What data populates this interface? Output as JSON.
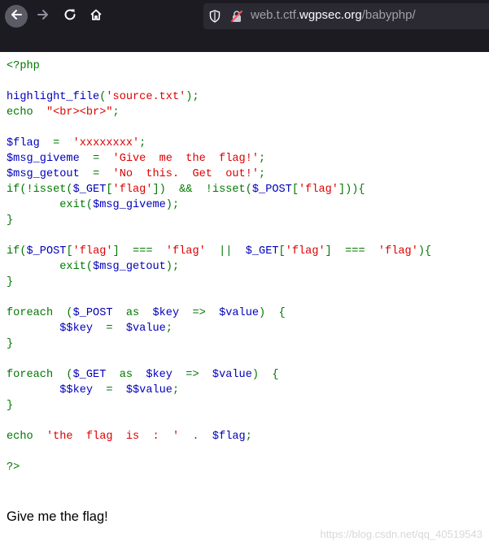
{
  "browser": {
    "url_prefix": "web.t.ctf.",
    "url_domain": "wgpsec.org",
    "url_path": "/babyphp/"
  },
  "source_code": [
    [
      [
        "k",
        "<?php"
      ]
    ],
    [],
    [
      [
        "v",
        "highlight_file"
      ],
      [
        "k",
        "("
      ],
      [
        "s",
        "'source.txt'"
      ],
      [
        "k",
        ");"
      ]
    ],
    [
      [
        "k",
        "echo  "
      ],
      [
        "s",
        "\"<br><br>\""
      ],
      [
        "k",
        ";"
      ]
    ],
    [],
    [
      [
        "v",
        "$flag  "
      ],
      [
        "k",
        "= "
      ],
      [
        "s",
        " 'xxxxxxxx'"
      ],
      [
        "k",
        ";"
      ]
    ],
    [
      [
        "v",
        "$msg_giveme  "
      ],
      [
        "k",
        "= "
      ],
      [
        "s",
        " 'Give  me  the  flag!'"
      ],
      [
        "k",
        ";"
      ]
    ],
    [
      [
        "v",
        "$msg_getout  "
      ],
      [
        "k",
        "= "
      ],
      [
        "s",
        " 'No  this.  Get  out!'"
      ],
      [
        "k",
        ";"
      ]
    ],
    [
      [
        "k",
        "if(!isset("
      ],
      [
        "v",
        "$_GET"
      ],
      [
        "k",
        "["
      ],
      [
        "s",
        "'flag'"
      ],
      [
        "k",
        "])  &&  !isset("
      ],
      [
        "v",
        "$_POST"
      ],
      [
        "k",
        "["
      ],
      [
        "s",
        "'flag'"
      ],
      [
        "k",
        "])){"
      ]
    ],
    [
      [
        "k",
        "        exit("
      ],
      [
        "v",
        "$msg_giveme"
      ],
      [
        "k",
        ");"
      ]
    ],
    [
      [
        "k",
        "}"
      ]
    ],
    [],
    [
      [
        "k",
        "if("
      ],
      [
        "v",
        "$_POST"
      ],
      [
        "k",
        "["
      ],
      [
        "s",
        "'flag'"
      ],
      [
        "k",
        "]  ===  "
      ],
      [
        "s",
        "'flag'"
      ],
      [
        "k",
        "  ||  "
      ],
      [
        "v",
        "$_GET"
      ],
      [
        "k",
        "["
      ],
      [
        "s",
        "'flag'"
      ],
      [
        "k",
        "]  ===  "
      ],
      [
        "s",
        "'flag'"
      ],
      [
        "k",
        "){"
      ]
    ],
    [
      [
        "k",
        "        exit("
      ],
      [
        "v",
        "$msg_getout"
      ],
      [
        "k",
        ");"
      ]
    ],
    [
      [
        "k",
        "}"
      ]
    ],
    [],
    [
      [
        "k",
        "foreach  ("
      ],
      [
        "v",
        "$_POST  "
      ],
      [
        "k",
        "as  "
      ],
      [
        "v",
        "$key  "
      ],
      [
        "k",
        "=>  "
      ],
      [
        "v",
        "$value"
      ],
      [
        "k",
        ")  {"
      ]
    ],
    [
      [
        "v",
        "        $$key  "
      ],
      [
        "k",
        "=  "
      ],
      [
        "v",
        "$value"
      ],
      [
        "k",
        ";"
      ]
    ],
    [
      [
        "k",
        "}"
      ]
    ],
    [],
    [
      [
        "k",
        "foreach  ("
      ],
      [
        "v",
        "$_GET  "
      ],
      [
        "k",
        "as  "
      ],
      [
        "v",
        "$key  "
      ],
      [
        "k",
        "=>  "
      ],
      [
        "v",
        "$value"
      ],
      [
        "k",
        ")  {"
      ]
    ],
    [
      [
        "v",
        "        $$key  "
      ],
      [
        "k",
        "=  "
      ],
      [
        "v",
        "$$value"
      ],
      [
        "k",
        ";"
      ]
    ],
    [
      [
        "k",
        "}"
      ]
    ],
    [],
    [
      [
        "k",
        "echo  "
      ],
      [
        "s",
        "'the  flag  is  :  '"
      ],
      [
        "k",
        "  .  "
      ],
      [
        "v",
        "$flag"
      ],
      [
        "k",
        ";"
      ]
    ],
    [],
    [
      [
        "k",
        "?>"
      ]
    ]
  ],
  "output_text": "Give me the flag!",
  "watermark": "https://blog.csdn.net/qq_40519543",
  "colors": {
    "keyword": "#007700",
    "variable": "#0000bb",
    "string": "#dd0000",
    "toolbar": "#1c1b22",
    "urlbar": "#2b2a33"
  }
}
